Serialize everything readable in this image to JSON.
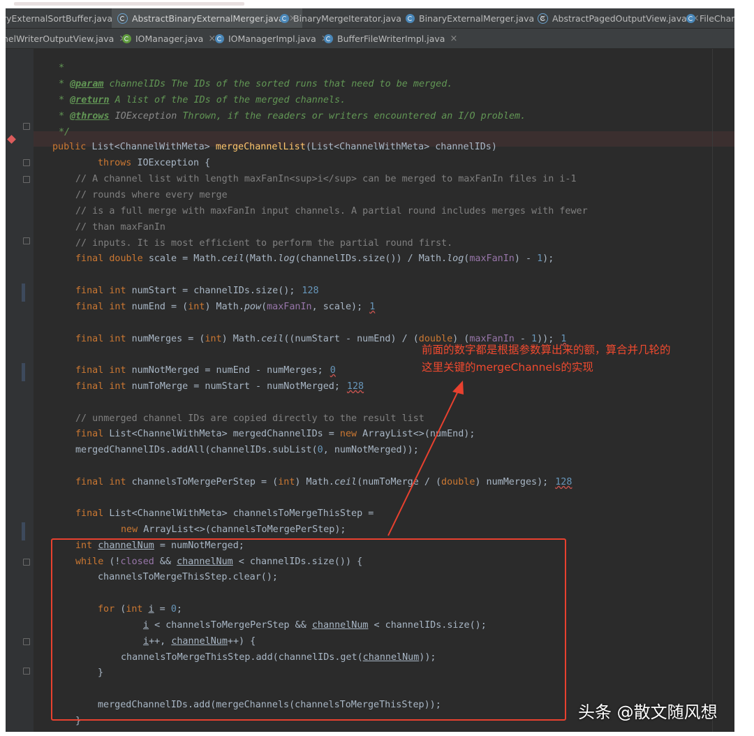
{
  "tabs_row1": [
    {
      "label": "ryExternalSortBuffer.java",
      "icon": "class-icon",
      "active": false,
      "close": "×"
    },
    {
      "label": "AbstractBinaryExternalMerger.java",
      "icon": "abstract-class-icon",
      "active": true,
      "close": "×"
    },
    {
      "label": "BinaryMergeIterator.java",
      "icon": "class-icon",
      "active": false,
      "close": "×"
    },
    {
      "label": "BinaryExternalMerger.java",
      "icon": "class-icon",
      "active": false,
      "close": "×"
    },
    {
      "label": "AbstractPagedOutputView.java",
      "icon": "abstract-class-icon",
      "active": false,
      "close": "×"
    },
    {
      "label": "FileChann",
      "icon": "class-icon",
      "active": false,
      "close": ""
    }
  ],
  "tabs_row2": [
    {
      "label": "nelWriterOutputView.java",
      "icon": "",
      "active": false,
      "close": "×"
    },
    {
      "label": "IOManager.java",
      "icon": "interface-icon",
      "active": false,
      "close": "×"
    },
    {
      "label": "IOManagerImpl.java",
      "icon": "class-icon",
      "active": false,
      "close": "×"
    },
    {
      "label": "BufferFileWriterImpl.java",
      "icon": "class-icon",
      "active": false,
      "close": "×"
    }
  ],
  "code": {
    "l01": "*",
    "l02": {
      "star": "* ",
      "tag": "@param",
      "arg": " channelIDs",
      "text": " The IDs of the sorted runs that need to be merged."
    },
    "l03": {
      "star": "* ",
      "tag": "@return",
      "text": " A list of the IDs of the merged channels."
    },
    "l04": {
      "star": "* ",
      "tag": "@throws",
      "arg": " IOException",
      "text": " Thrown, if the readers or writers encountered an I/O problem."
    },
    "l05": "*/",
    "l06": {
      "kw": "public ",
      "t1": "List<ChannelWithMeta> ",
      "fn": "mergeChannelList",
      "t2": "(List<ChannelWithMeta> channelIDs)"
    },
    "l07": {
      "kw": "throws ",
      "t": "IOException {"
    },
    "l08": "// A channel list with length maxFanIn<sup>i</sup> can be merged to maxFanIn files in i-1",
    "l09": "// rounds where every merge",
    "l10": "// is a full merge with maxFanIn input channels. A partial round includes merges with fewer",
    "l11": "// than maxFanIn",
    "l12": "// inputs. It is most efficient to perform the partial round first.",
    "l13": {
      "kw": "final double ",
      "a": "scale = Math.",
      "ceil": "ceil",
      "b": "(Math.",
      "log1": "log",
      "c": "(channelIDs.size()) / Math.",
      "log2": "log",
      "d": "(",
      "fld": "maxFanIn",
      "e": ") - ",
      "num": "1",
      "f": ");"
    },
    "l14": {
      "kw": "final int ",
      "a": "numStart = channelIDs.size();",
      "hint": "128"
    },
    "l15": {
      "kw": "final int ",
      "a": "numEnd = (",
      "kw2": "int",
      "b": ") Math.",
      "pow": "pow",
      "c": "(",
      "fld": "maxFanIn",
      "d": ", scale);",
      "hint": "1"
    },
    "l16": {
      "kw": "final int ",
      "a": "numMerges = (",
      "kw2": "int",
      "b": ") Math.",
      "ceil": "ceil",
      "c": "((numStart - numEnd) / (",
      "kw3": "double",
      "d": ") (",
      "fld": "maxFanIn",
      "e": " - ",
      "num": "1",
      "f": "));",
      "hint": "1"
    },
    "l17": {
      "kw": "final int ",
      "a": "numNotMerged = numEnd - numMerges;",
      "hint": "0"
    },
    "l18": {
      "kw": "final int ",
      "a": "numToMerge = numStart - numNotMerged;",
      "hint": "128"
    },
    "l19": "// unmerged channel IDs are copied directly to the result list",
    "l20": {
      "kw": "final ",
      "a": "List<ChannelWithMeta> mergedChannelIDs = ",
      "kw2": "new ",
      "b": "ArrayList<>(numEnd);"
    },
    "l21": {
      "a": "mergedChannelIDs.addAll(channelIDs.subList(",
      "num": "0",
      "b": ", numNotMerged));"
    },
    "l22": {
      "kw": "final int ",
      "a": "channelsToMergePerStep = (",
      "kw2": "int",
      "b": ") Math.",
      "ceil": "ceil",
      "c": "(numToMerge / (",
      "kw3": "double",
      "d": ") numMerges);",
      "hint": "128"
    },
    "l23": {
      "kw": "final ",
      "a": "List<ChannelWithMeta> channelsToMergeThisStep ="
    },
    "l24": {
      "kw": "new ",
      "a": "ArrayList<>(channelsToMergePerStep);"
    },
    "l25": {
      "kw": "int ",
      "u": "channelNum",
      "a": " = numNotMerged;"
    },
    "l26": {
      "kw": "while ",
      "a": "(!",
      "fld": "closed",
      "b": " && ",
      "u": "channelNum",
      "c": " < channelIDs.size()) {"
    },
    "l27": "channelsToMergeThisStep.clear();",
    "l28": {
      "kw": "for ",
      "a": "(",
      "kw2": "int ",
      "u": "i",
      "b": " = ",
      "num": "0",
      "c": ";"
    },
    "l29": {
      "u1": "i",
      "a": " < channelsToMergePerStep && ",
      "u2": "channelNum",
      "b": " < channelIDs.size();"
    },
    "l30": {
      "u1": "i",
      "a": "++, ",
      "u2": "channelNum",
      "b": "++) {"
    },
    "l31": {
      "a": "channelsToMergeThisStep.add(channelIDs.get(",
      "u": "channelNum",
      "b": "));"
    },
    "l32": "}",
    "l33": "mergedChannelIDs.add(mergeChannels(channelsToMergeThisStep));",
    "l34": "}"
  },
  "annotation": {
    "line1": "前面的数字都是根据参数算出来的额，算合并几轮的",
    "line2": "这里关键的mergeChannels的实现",
    "color": "#e8412f"
  },
  "watermark": "头条 @散文随风想"
}
